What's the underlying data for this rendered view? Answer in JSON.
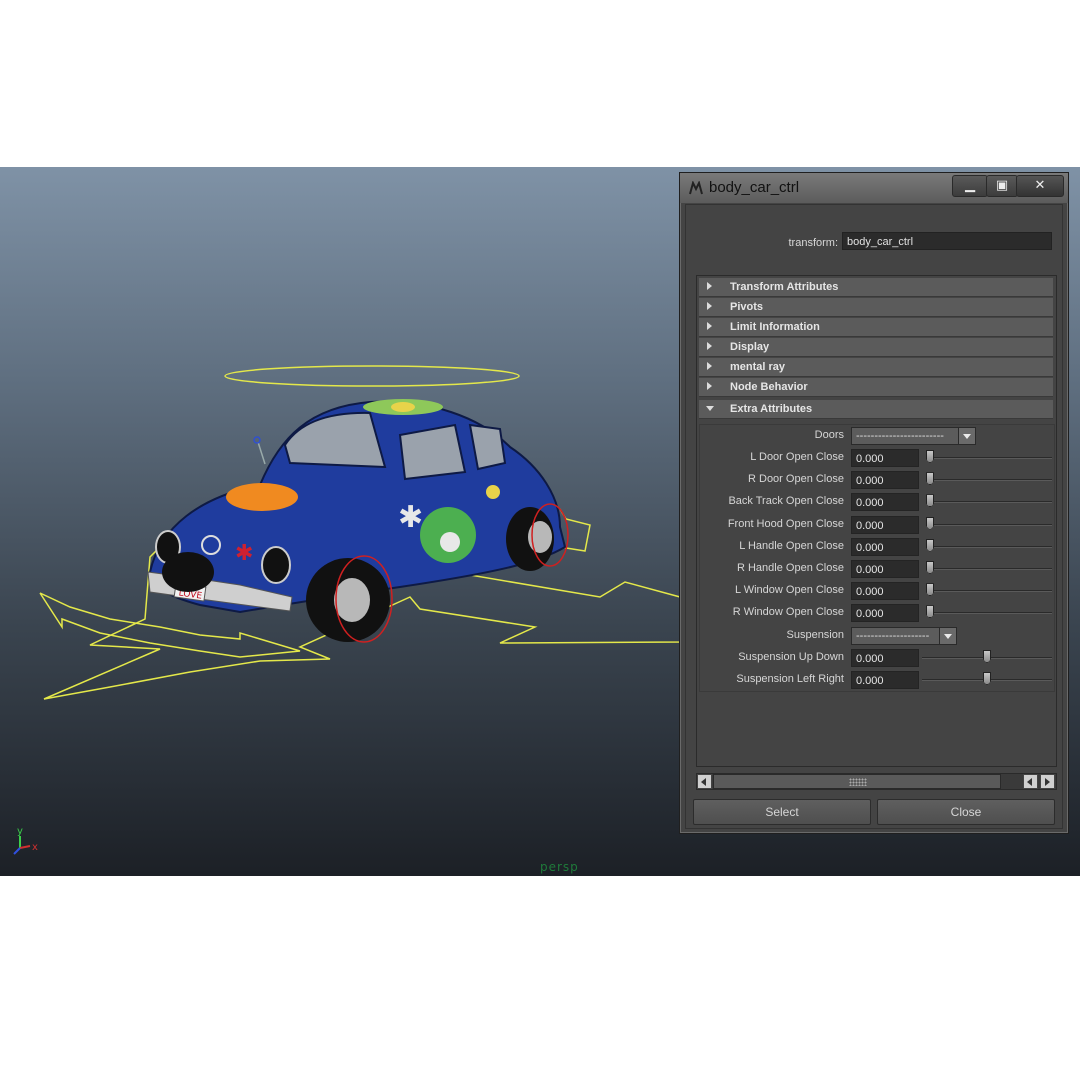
{
  "viewport": {
    "camera_label": "persp",
    "axis": {
      "y": "y",
      "x": "x"
    },
    "license_plate": "LOVE",
    "colors": {
      "curves": "#e4e84a",
      "selection": "#d02020",
      "car_body": "#1e3a9a"
    }
  },
  "window": {
    "title": "body_car_ctrl",
    "icon": "maya-icon",
    "controls": {
      "minimize": "minimize-icon",
      "maximize": "maximize-icon",
      "close": "close-icon"
    },
    "transform_label": "transform:",
    "transform_value": "body_car_ctrl",
    "sections": [
      {
        "label": "Transform Attributes",
        "expanded": false
      },
      {
        "label": "Pivots",
        "expanded": false
      },
      {
        "label": "Limit Information",
        "expanded": false
      },
      {
        "label": "Display",
        "expanded": false
      },
      {
        "label": "mental ray",
        "expanded": false
      },
      {
        "label": "Node Behavior",
        "expanded": false
      },
      {
        "label": "Extra Attributes",
        "expanded": true
      }
    ],
    "extra_attributes": {
      "doors": {
        "label": "Doors",
        "value": "------------------------"
      },
      "door_rows": [
        {
          "label": "L Door Open Close",
          "value": "0.000",
          "slider": 0
        },
        {
          "label": "R Door Open Close",
          "value": "0.000",
          "slider": 0
        },
        {
          "label": "Back Track Open Close",
          "value": "0.000",
          "slider": 0
        },
        {
          "label": "Front Hood Open Close",
          "value": "0.000",
          "slider": 0
        },
        {
          "label": "L Handle Open Close",
          "value": "0.000",
          "slider": 0
        },
        {
          "label": "R Handle Open Close",
          "value": "0.000",
          "slider": 0
        },
        {
          "label": "L Window Open Close",
          "value": "0.000",
          "slider": 0
        },
        {
          "label": "R Window Open Close",
          "value": "0.000",
          "slider": 0
        }
      ],
      "suspension": {
        "label": "Suspension",
        "value": "--------------------"
      },
      "suspension_rows": [
        {
          "label": "Suspension Up Down",
          "value": "0.000",
          "slider": 0.5
        },
        {
          "label": "Suspension Left Right",
          "value": "0.000",
          "slider": 0.5
        }
      ]
    },
    "buttons": {
      "select": "Select",
      "close": "Close"
    }
  }
}
